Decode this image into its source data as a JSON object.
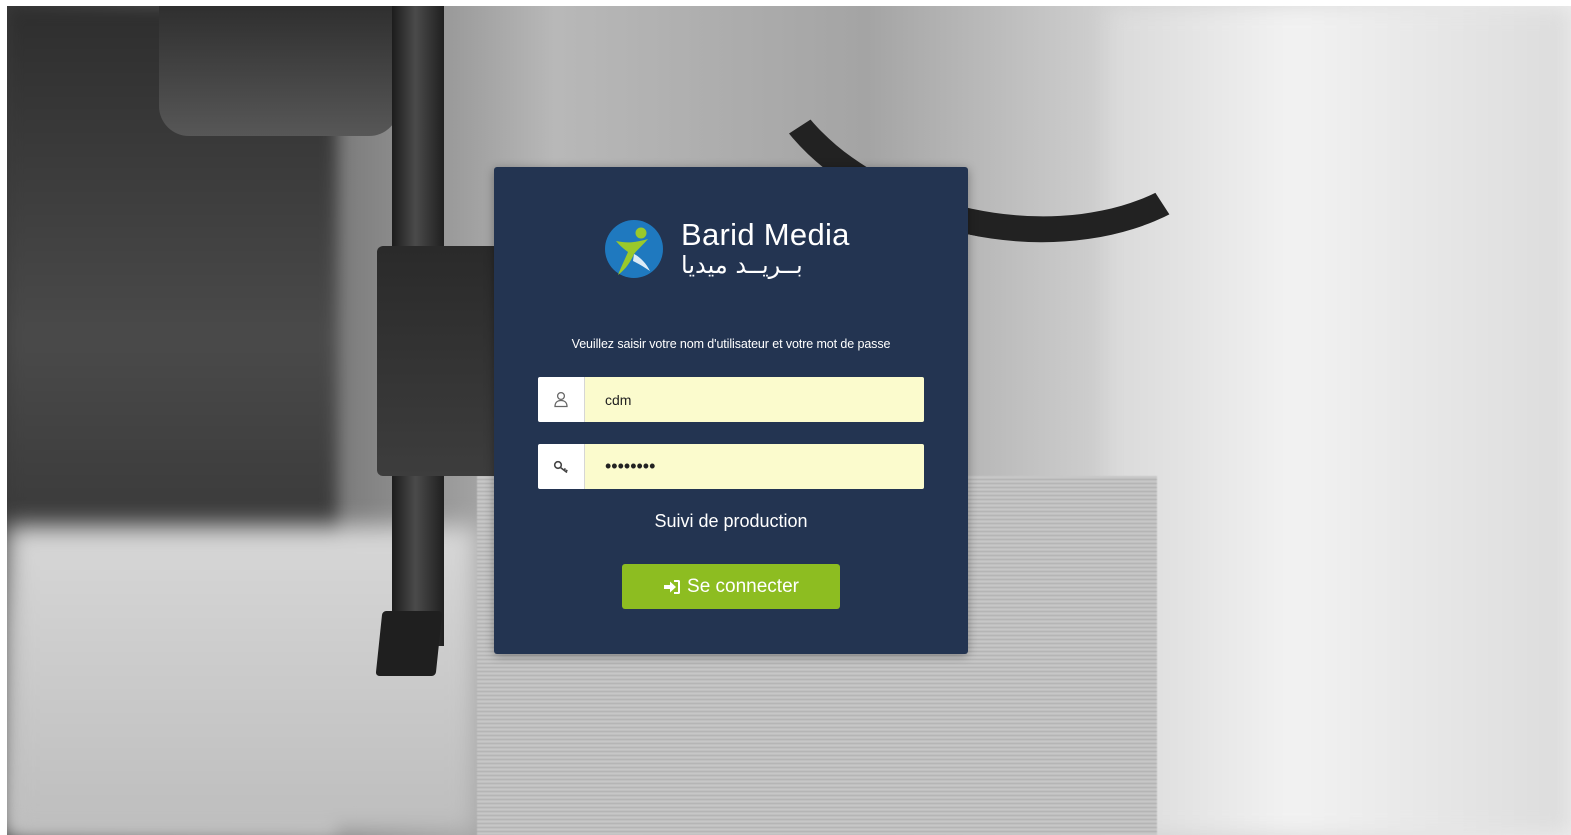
{
  "brand": {
    "name_latin": "Barid Media",
    "name_arabic": "بــريــد ميديا",
    "colors": {
      "circle": "#1f79bf",
      "figure": "#9ac92b"
    }
  },
  "login": {
    "instruction": "Veuillez saisir votre nom d'utilisateur et votre mot de passe",
    "username": {
      "icon": "user-icon",
      "value": "cdm"
    },
    "password": {
      "icon": "key-icon",
      "value": "••••••••"
    },
    "app_name": "Suivi de production",
    "submit": {
      "icon": "sign-in-icon",
      "label": "Se connecter"
    }
  },
  "colors": {
    "panel": "#233451",
    "input_fill": "#fbfbcd",
    "button": "#8dbd21"
  }
}
